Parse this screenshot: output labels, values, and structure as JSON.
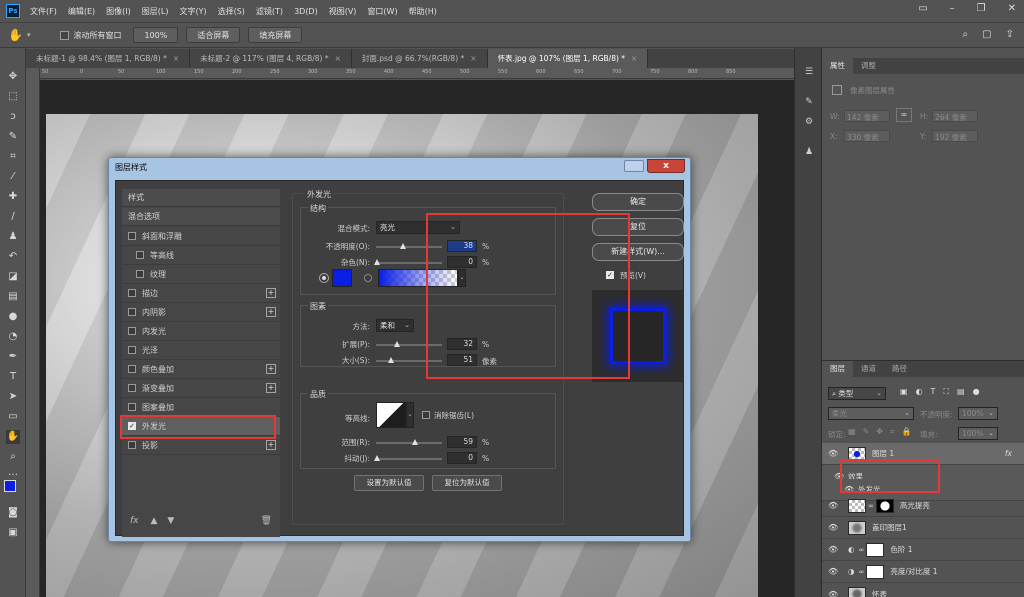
{
  "app": {
    "logo": "Ps",
    "menu": [
      "文件(F)",
      "编辑(E)",
      "图像(I)",
      "图层(L)",
      "文字(Y)",
      "选择(S)",
      "滤镜(T)",
      "3D(D)",
      "视图(V)",
      "窗口(W)",
      "帮助(H)"
    ]
  },
  "options": {
    "scroll_all_label": "滚动所有窗口",
    "zoom_100": "100%",
    "fit_screen": "适合屏幕",
    "fill_screen": "填充屏幕"
  },
  "tabs": [
    {
      "label": "未标题-1 @ 98.4% (图层 1, RGB/8) *"
    },
    {
      "label": "未标题-2 @ 117% (图层 4, RGB/8) *"
    },
    {
      "label": "封面.psd @ 66.7%(RGB/8) *"
    },
    {
      "label": "怀表.jpg @ 107% (图层 1, RGB/8) *"
    }
  ],
  "ruler": {
    "h_ticks": [
      "50",
      "0",
      "50",
      "100",
      "150",
      "200",
      "250",
      "300",
      "350",
      "400",
      "450",
      "500",
      "550",
      "600",
      "650",
      "700",
      "750",
      "800",
      "850"
    ]
  },
  "dialog": {
    "title": "图层样式",
    "close": "x",
    "style_list": {
      "header_styles": "样式",
      "header_blend": "混合选项",
      "items": [
        {
          "label": "斜面和浮雕",
          "sub": false,
          "plus": false,
          "checked": false
        },
        {
          "label": "等高线",
          "sub": true,
          "plus": false,
          "checked": false
        },
        {
          "label": "纹理",
          "sub": true,
          "plus": false,
          "checked": false
        },
        {
          "label": "描边",
          "sub": false,
          "plus": true,
          "checked": false
        },
        {
          "label": "内阴影",
          "sub": false,
          "plus": true,
          "checked": false
        },
        {
          "label": "内发光",
          "sub": false,
          "plus": false,
          "checked": false
        },
        {
          "label": "光泽",
          "sub": false,
          "plus": false,
          "checked": false
        },
        {
          "label": "颜色叠加",
          "sub": false,
          "plus": true,
          "checked": false
        },
        {
          "label": "渐变叠加",
          "sub": false,
          "plus": true,
          "checked": false
        },
        {
          "label": "图案叠加",
          "sub": false,
          "plus": false,
          "checked": false
        },
        {
          "label": "外发光",
          "sub": false,
          "plus": false,
          "checked": true
        },
        {
          "label": "投影",
          "sub": false,
          "plus": true,
          "checked": false
        }
      ],
      "footer_fx": "fx"
    },
    "outer_glow": {
      "title": "外发光",
      "structure": {
        "title": "结构",
        "blend_mode_label": "混合模式:",
        "blend_mode_value": "亮光",
        "opacity_label": "不透明度(O):",
        "opacity_value": "38",
        "noise_label": "杂色(N):",
        "noise_value": "0",
        "percent": "%",
        "glow_color": "#0a1ee6"
      },
      "elements": {
        "title": "图素",
        "technique_label": "方法:",
        "technique_value": "柔和",
        "spread_label": "扩展(P):",
        "spread_value": "32",
        "size_label": "大小(S):",
        "size_value": "51",
        "px_unit": "像素"
      },
      "quality": {
        "title": "品质",
        "contour_label": "等高线:",
        "antialias_label": "消除锯齿(L)",
        "range_label": "范围(R):",
        "range_value": "59",
        "jitter_label": "抖动(J):",
        "jitter_value": "0"
      },
      "set_default": "设置为默认值",
      "reset_default": "复位为默认值"
    },
    "buttons": {
      "ok": "确定",
      "reset": "复位",
      "new_style": "新建样式(W)...",
      "preview_label": "预览(V)"
    }
  },
  "properties": {
    "tabs": [
      "属性",
      "调整"
    ],
    "pixel_layer_label": "像素图层属性",
    "w_label": "W:",
    "w_value": "142 像素",
    "h_label": "H:",
    "h_value": "264 像素",
    "x_label": "X:",
    "x_value": "330 像素",
    "y_label": "Y:",
    "y_value": "192 像素"
  },
  "layers": {
    "tabs": [
      "图层",
      "通道",
      "路径"
    ],
    "kind_label": "类型",
    "blend_mode": "柔光",
    "opacity_label": "不透明度:",
    "opacity_value": "100%",
    "lock_label": "锁定:",
    "fill_label": "填充:",
    "fill_value": "100%",
    "rows": [
      {
        "name": "图层 1",
        "fx": "fx"
      },
      {
        "name": "效果"
      },
      {
        "name": "外发光"
      },
      {
        "name": "高光提亮"
      },
      {
        "name": "盖印图层1"
      },
      {
        "name": "色阶 1"
      },
      {
        "name": "亮度/对比度 1"
      },
      {
        "name": "怀表"
      }
    ]
  }
}
